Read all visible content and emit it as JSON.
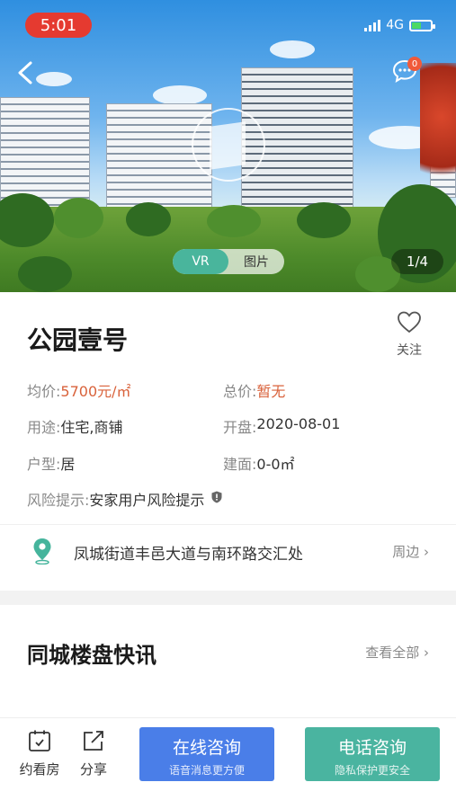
{
  "status_bar": {
    "time": "5:01",
    "network": "4G"
  },
  "hero": {
    "message_count": "0",
    "media_tabs": [
      "VR",
      "图片"
    ],
    "active_tab": "VR",
    "photo_counter": "1/4"
  },
  "property": {
    "name": "公园壹号",
    "follow_label": "关注",
    "avg_price_label": "均价:",
    "avg_price_value": "5700元/㎡",
    "total_price_label": "总价:",
    "total_price_value": "暂无",
    "usage_label": "用途:",
    "usage_value": "住宅,商铺",
    "opening_label": "开盘:",
    "opening_value": "2020-08-01",
    "layout_label": "户型:",
    "layout_value": "居",
    "area_label": "建面:",
    "area_value": "0-0㎡",
    "risk_label": "风险提示:",
    "risk_value": "安家用户风险提示",
    "address": "凤城街道丰邑大道与南环路交汇处",
    "nearby_label": "周边"
  },
  "news": {
    "title": "同城楼盘快讯",
    "see_all": "查看全部"
  },
  "bottom_bar": {
    "appointment_label": "约看房",
    "share_label": "分享",
    "online_title": "在线咨询",
    "online_sub": "语音消息更方便",
    "phone_title": "电话咨询",
    "phone_sub": "隐私保护更安全"
  },
  "colors": {
    "accent_blue": "#4a7ee8",
    "accent_green": "#4ab4a0",
    "price_red": "#d9623b",
    "status_red": "#e53a30"
  }
}
